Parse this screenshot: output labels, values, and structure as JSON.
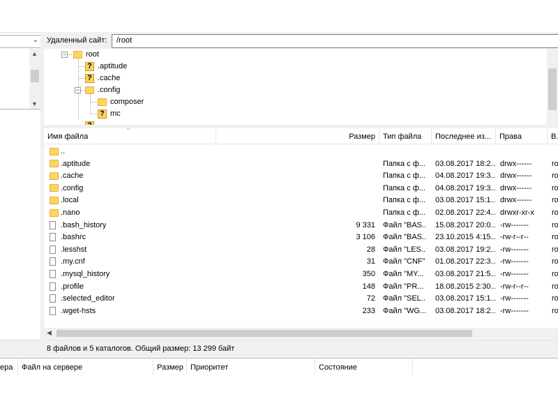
{
  "remote": {
    "label": "Удаленный сайт:",
    "path": "/root"
  },
  "tree": {
    "items": [
      {
        "label": "root",
        "icon": "folder-icon"
      },
      {
        "label": ".aptitude",
        "icon": "unknown-folder-icon"
      },
      {
        "label": ".cache",
        "icon": "unknown-folder-icon"
      },
      {
        "label": ".config",
        "icon": "folder-icon"
      },
      {
        "label": "composer",
        "icon": "folder-icon"
      },
      {
        "label": "mc",
        "icon": "unknown-folder-icon"
      }
    ]
  },
  "list": {
    "columns": {
      "name": "Имя файла",
      "size": "Размер",
      "type": "Тип файла",
      "modified": "Последнее из...",
      "perms": "Права",
      "owner": "В..."
    },
    "rows": [
      {
        "name": "..",
        "size": "",
        "type": "",
        "date": "",
        "perm": "",
        "owner": "",
        "icon": "folder"
      },
      {
        "name": ".aptitude",
        "size": "",
        "type": "Папка с ф...",
        "date": "03.08.2017 18:2...",
        "perm": "drwx------",
        "owner": "ro",
        "icon": "folder"
      },
      {
        "name": ".cache",
        "size": "",
        "type": "Папка с ф...",
        "date": "04.08.2017 19:3...",
        "perm": "drwx------",
        "owner": "ro",
        "icon": "folder"
      },
      {
        "name": ".config",
        "size": "",
        "type": "Папка с ф...",
        "date": "04.08.2017 19:3...",
        "perm": "drwx------",
        "owner": "ro",
        "icon": "folder"
      },
      {
        "name": ".local",
        "size": "",
        "type": "Папка с ф...",
        "date": "03.08.2017 15:1...",
        "perm": "drwx------",
        "owner": "ro",
        "icon": "folder"
      },
      {
        "name": ".nano",
        "size": "",
        "type": "Папка с ф...",
        "date": "02.08.2017 22:4...",
        "perm": "drwxr-xr-x",
        "owner": "ro",
        "icon": "folder"
      },
      {
        "name": ".bash_history",
        "size": "9 331",
        "type": "Файл \"BAS...",
        "date": "15.08.2017 20:0...",
        "perm": "-rw-------",
        "owner": "ro",
        "icon": "file"
      },
      {
        "name": ".bashrc",
        "size": "3 106",
        "type": "Файл \"BAS...",
        "date": "23.10.2015 4:15...",
        "perm": "-rw-r--r--",
        "owner": "ro",
        "icon": "file"
      },
      {
        "name": ".lesshst",
        "size": "28",
        "type": "Файл \"LES...",
        "date": "03.08.2017 19:2...",
        "perm": "-rw-------",
        "owner": "ro",
        "icon": "file"
      },
      {
        "name": ".my.cnf",
        "size": "31",
        "type": "Файл \"CNF\"",
        "date": "01.08.2017 22:3...",
        "perm": "-rw-------",
        "owner": "ro",
        "icon": "file"
      },
      {
        "name": ".mysql_history",
        "size": "350",
        "type": "Файл \"MY...",
        "date": "03.08.2017 21:5...",
        "perm": "-rw-------",
        "owner": "ro",
        "icon": "file"
      },
      {
        "name": ".profile",
        "size": "148",
        "type": "Файл \"PR...",
        "date": "18.08.2015 2:30...",
        "perm": "-rw-r--r--",
        "owner": "ro",
        "icon": "file"
      },
      {
        "name": ".selected_editor",
        "size": "72",
        "type": "Файл \"SEL...",
        "date": "03.08.2017 15:1...",
        "perm": "-rw-------",
        "owner": "ro",
        "icon": "file"
      },
      {
        "name": ".wget-hsts",
        "size": "233",
        "type": "Файл \"WG...",
        "date": "03.08.2017 18:2...",
        "perm": "-rw-------",
        "owner": "ro",
        "icon": "file"
      }
    ]
  },
  "status": {
    "text": "8 файлов и 5 каталогов. Общий размер: 13 299 байт"
  },
  "queue": {
    "columns": {
      "local": "ера",
      "server_file": "Файл на сервере",
      "size": "Размер",
      "priority": "Приоритет",
      "state": "Состояние"
    }
  }
}
